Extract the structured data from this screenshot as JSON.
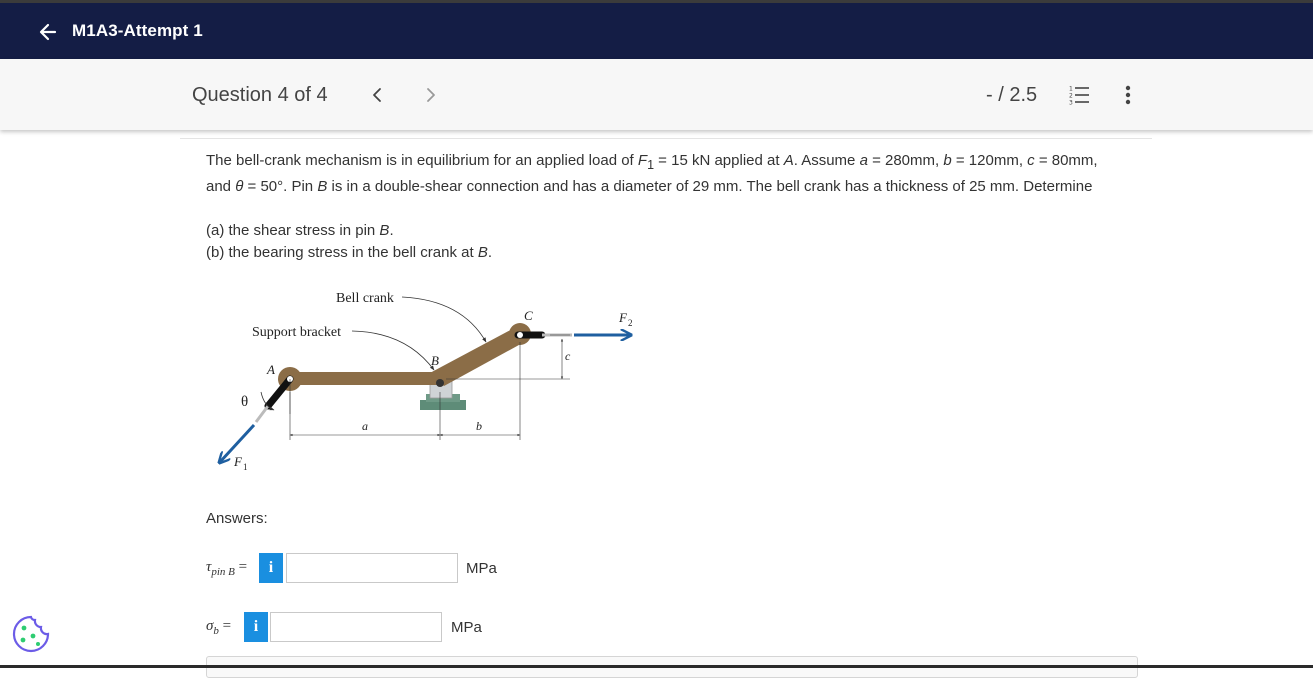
{
  "header": {
    "title": "M1A3-Attempt 1"
  },
  "question_bar": {
    "counter": "Question 4 of 4",
    "score": "- / 2.5"
  },
  "problem": {
    "line1_pre": "The bell-crank mechanism is in equilibrium for an applied load of ",
    "F1_sym": "F",
    "F1_sub": "1",
    "line1_mid": " = 15 kN applied at ",
    "pointA": "A",
    "line1_post": ". Assume ",
    "a_sym": "a",
    "a_val": " = 280mm, ",
    "b_sym": "b",
    "b_val": " = 120mm, ",
    "c_sym": "c",
    "c_val": " = 80mm,",
    "line2_pre": "and ",
    "theta_sym": "θ",
    "theta_val": " = 50°. Pin ",
    "pinB": "B",
    "line2_post": " is in a double-shear connection and has a diameter of 29 mm. The bell crank has a thickness of 25 mm. Determine",
    "part_a_pre": "(a) the shear stress in pin ",
    "part_a_B": "B",
    "part_a_post": ".",
    "part_b_pre": "(b) the bearing stress in the bell crank at ",
    "part_b_B": "B",
    "part_b_post": "."
  },
  "diagram": {
    "label_bell_crank": "Bell crank",
    "label_support_bracket": "Support bracket",
    "label_A": "A",
    "label_B": "B",
    "label_C": "C",
    "label_theta": "θ",
    "label_F1": "F",
    "label_F1_sub": "1",
    "label_F2": "F",
    "label_F2_sub": "2",
    "label_a": "a",
    "label_b": "b",
    "label_c": "c",
    "colors": {
      "crank": "#8b6d47",
      "base": "#5e8c78",
      "force": "#1f5fa0"
    }
  },
  "answers": {
    "label": "Answers:",
    "row1": {
      "sym": "τ",
      "sub": "pin B",
      "eq": " =",
      "info": "i",
      "value": "",
      "unit": "MPa"
    },
    "row2": {
      "sym": "σ",
      "sub": "b",
      "eq": " =",
      "info": "i",
      "value": "",
      "unit": "MPa"
    }
  },
  "icons": {
    "back": "arrow-left-icon",
    "prev": "chevron-left-icon",
    "next": "chevron-right-icon",
    "list": "numbered-list-icon",
    "more": "vertical-ellipsis-icon",
    "cookie": "cookie-icon"
  },
  "theme": {
    "header_bg": "#141d45",
    "info_btn": "#1a8fe0"
  }
}
